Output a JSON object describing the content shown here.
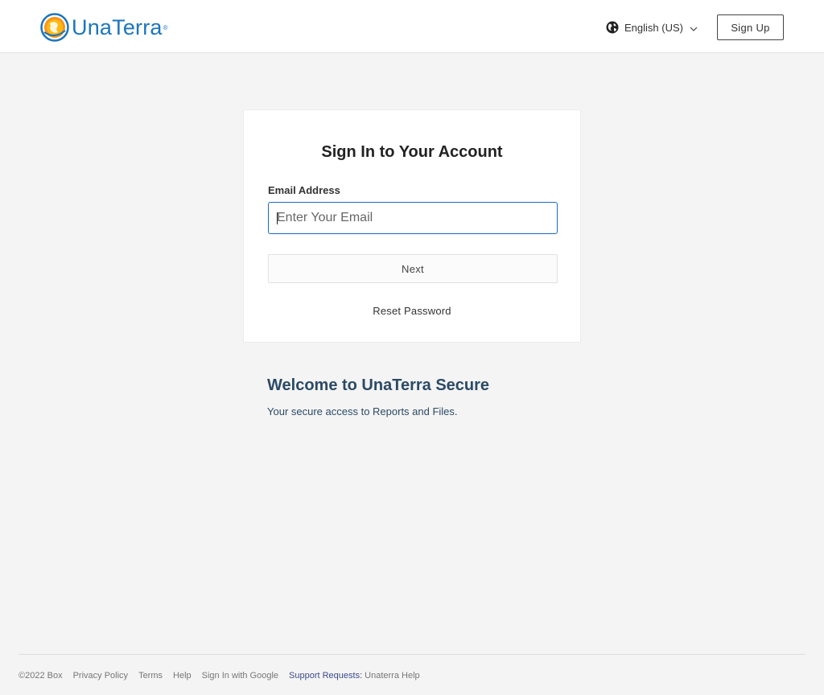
{
  "header": {
    "logo_text": "UnaTerra",
    "logo_mark": "®",
    "language": "English (US)",
    "signup_label": "Sign Up"
  },
  "icons": {
    "logo": "unaterra-globe-logo-icon",
    "language": "globe-icon",
    "language_dropdown": "chevron-down-icon"
  },
  "signin": {
    "title": "Sign In to Your Account",
    "email_label": "Email Address",
    "email_value": "",
    "email_placeholder": "Enter Your Email",
    "next_label": "Next",
    "reset_label": "Reset Password"
  },
  "welcome": {
    "title": "Welcome to UnaTerra Secure",
    "subtitle": "Your secure access to Reports and Files."
  },
  "footer": {
    "copyright": "©2022 Box",
    "privacy": "Privacy Policy",
    "terms": "Terms",
    "help": "Help",
    "google": "Sign In with Google",
    "support_label": "Support Requests:",
    "support_link": "Unaterra Help"
  },
  "colors": {
    "brand_blue": "#1b75bb",
    "logo_orange": "#f7941d",
    "input_focus": "#1b6bc0",
    "welcome_text": "#2b4a66",
    "page_bg": "#f4f4f4"
  }
}
